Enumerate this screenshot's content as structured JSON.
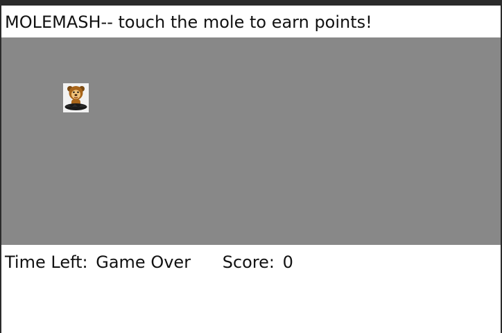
{
  "header": {
    "title": "MOLEMASH-- touch the mole to earn points!"
  },
  "game": {
    "background_color": "#888888",
    "mole": {
      "icon": "mole-icon"
    }
  },
  "status": {
    "time_label": "Time Left:",
    "time_value": "Game Over",
    "score_label": "Score:",
    "score_value": "0"
  }
}
